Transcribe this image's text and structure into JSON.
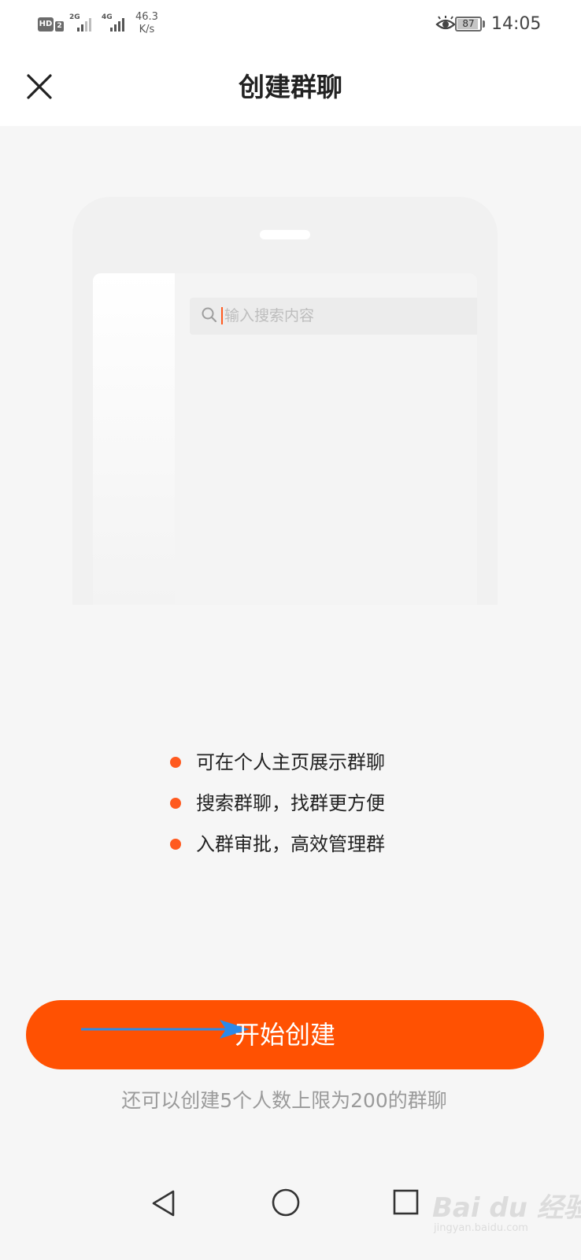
{
  "status_bar": {
    "hd": "HD",
    "hd_sub": "2",
    "net1": "2G",
    "net2": "4G",
    "speed_value": "46.3",
    "speed_unit": "K/s",
    "battery": "87",
    "time": "14:05"
  },
  "header": {
    "title": "创建群聊",
    "close_icon": "close-icon"
  },
  "illustration": {
    "search_placeholder": "输入搜索内容"
  },
  "features": [
    {
      "text": "可在个人主页展示群聊"
    },
    {
      "text": "搜索群聊，找群更方便"
    },
    {
      "text": "入群审批，高效管理群"
    }
  ],
  "colors": {
    "accent": "#ff5102",
    "dot": "#ff5a1f",
    "arrow": "#2b8ae8",
    "background": "#f6f6f6"
  },
  "primary_button": {
    "label": "开始创建"
  },
  "hint": "还可以创建5个人数上限为200的群聊",
  "system_nav": {
    "back_icon": "back-triangle-icon",
    "home_icon": "home-circle-icon",
    "recent_icon": "recent-square-icon"
  },
  "watermark": {
    "text": "Bai du 经验",
    "sub": "jingyan.baidu.com"
  }
}
